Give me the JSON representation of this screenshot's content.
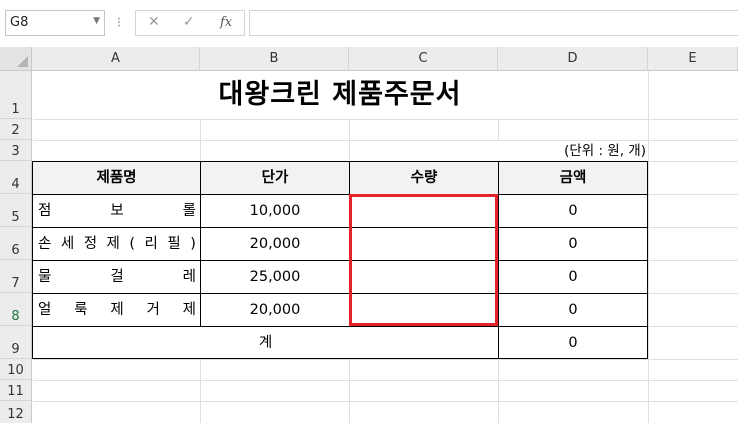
{
  "formula_bar": {
    "name_box": "G8",
    "separator": "⁝",
    "cancel": "✕",
    "enter": "✓",
    "fx": "fx",
    "formula": ""
  },
  "columns": [
    "A",
    "B",
    "C",
    "D",
    "E"
  ],
  "rows": [
    "1",
    "2",
    "3",
    "4",
    "5",
    "6",
    "7",
    "8",
    "9",
    "10",
    "11",
    "12"
  ],
  "sheet": {
    "title": "대왕크린 제품주문서",
    "unit_note": "(단위 : 원, 개)",
    "headers": [
      "제품명",
      "단가",
      "수량",
      "금액"
    ],
    "items": [
      {
        "name_chars": [
          "점",
          "보",
          "롤"
        ],
        "price": "10,000",
        "qty": "",
        "amount": "0"
      },
      {
        "name_chars": [
          "손",
          "세",
          "정",
          "제",
          "(",
          "리",
          "필",
          ")"
        ],
        "price": "20,000",
        "qty": "",
        "amount": "0"
      },
      {
        "name_chars": [
          "물",
          "걸",
          "레"
        ],
        "price": "25,000",
        "qty": "",
        "amount": "0"
      },
      {
        "name_chars": [
          "얼",
          "룩",
          "제",
          "거",
          "제"
        ],
        "price": "20,000",
        "qty": "",
        "amount": "0"
      }
    ],
    "total_label": "계",
    "total_amount": "0"
  },
  "colors": {
    "highlight_border": "#e3232c",
    "selected_row_text": "#1e7145"
  }
}
